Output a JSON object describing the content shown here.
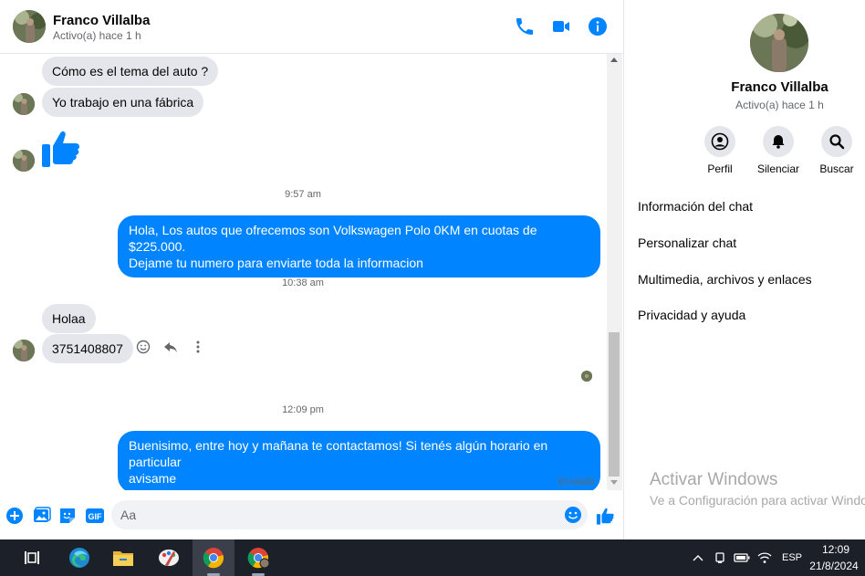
{
  "colors": {
    "accent": "#0084ff",
    "incoming_bubble": "#e4e6eb",
    "secondary_text": "#65676b",
    "taskbar": "#1c2029"
  },
  "header": {
    "contact_name": "Franco Villalba",
    "status": "Activo(a) hace 1 h",
    "icons": [
      "phone-icon",
      "video-icon",
      "info-icon"
    ]
  },
  "messages": {
    "incoming_1": "Cómo es el tema del auto ?",
    "incoming_2": "Yo trabajo en una fábrica",
    "thumbs_up": "thumbs-up-emoji",
    "time_1": "9:57 am",
    "outgoing_1_line1": "Hola, Los autos que ofrecemos son Volkswagen Polo 0KM en cuotas de $225.000.",
    "outgoing_1_line2": "Dejame tu numero para enviarte toda la informacion",
    "time_2": "10:38 am",
    "incoming_3": "Holaa",
    "incoming_4": "3751408807",
    "time_3": "12:09 pm",
    "outgoing_2_line1": "Buenisimo, entre hoy y mañana te contactamos! Si tenés algún horario en particular",
    "outgoing_2_line2": "avisame",
    "sent_status": "Enviado"
  },
  "composer": {
    "placeholder": "Aa",
    "value": "",
    "buttons": [
      "add-icon",
      "image-icon",
      "sticker-icon",
      "gif-icon",
      "emoji-icon",
      "thumbs-up-icon"
    ],
    "gif_label": "GIF"
  },
  "details": {
    "contact_name": "Franco Villalba",
    "status": "Activo(a) hace 1 h",
    "actions": [
      {
        "label": "Perfil",
        "icon": "profile-icon"
      },
      {
        "label": "Silenciar",
        "icon": "bell-icon"
      },
      {
        "label": "Buscar",
        "icon": "search-icon"
      }
    ],
    "menu": [
      "Información del chat",
      "Personalizar chat",
      "Multimedia, archivos y enlaces",
      "Privacidad y ayuda"
    ],
    "watermark_title": "Activar Windows",
    "watermark_sub": "Ve a Configuración para activar Windows."
  },
  "taskbar": {
    "apps": [
      "task-view-icon",
      "edge-icon",
      "file-explorer-icon",
      "paint-icon",
      "chrome-icon",
      "chrome-profile-icon"
    ],
    "language": "ESP",
    "time": "12:09",
    "date": "21/8/2024"
  }
}
